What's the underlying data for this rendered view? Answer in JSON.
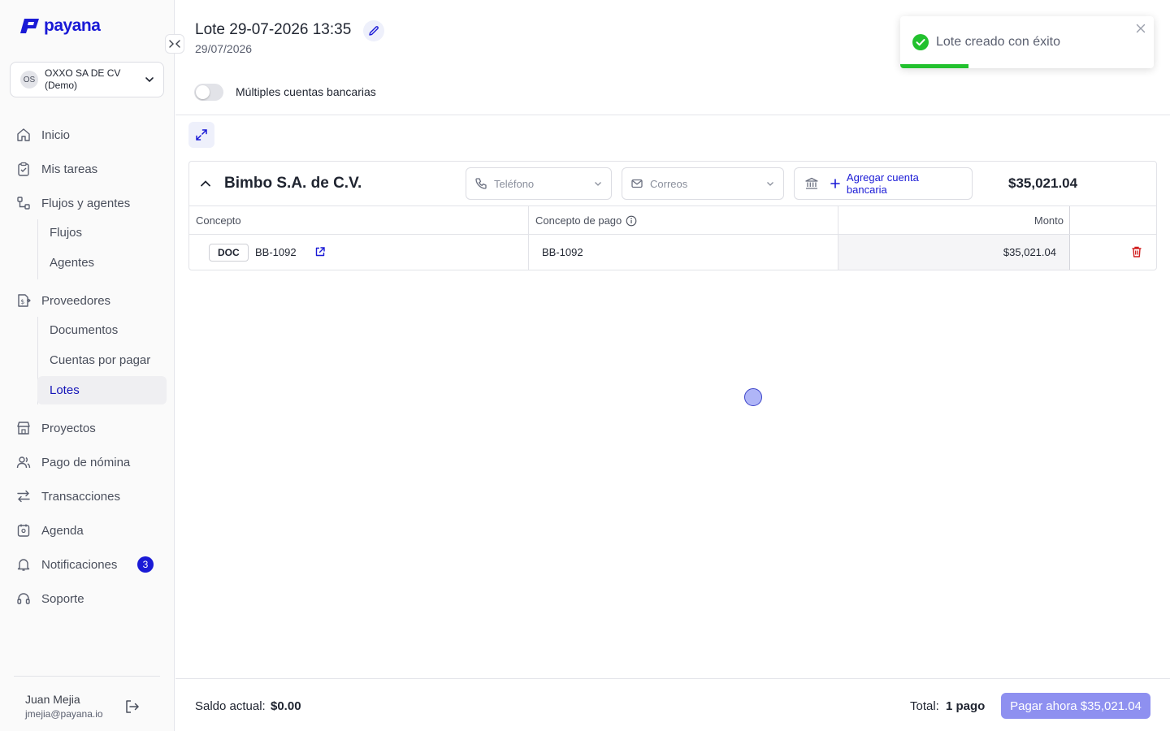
{
  "app": {
    "brand": "payana",
    "accent_color": "#1a1ad6"
  },
  "company": {
    "initials": "OS",
    "name": "OXXO SA DE CV (Demo)"
  },
  "nav": {
    "inicio": "Inicio",
    "tareas": "Mis tareas",
    "flujos_agentes": "Flujos y agentes",
    "flujos": "Flujos",
    "agentes": "Agentes",
    "proveedores": "Proveedores",
    "documentos": "Documentos",
    "cuentas": "Cuentas por pagar",
    "lotes": "Lotes",
    "proyectos": "Proyectos",
    "nomina": "Pago de nómina",
    "transacciones": "Transacciones",
    "agenda": "Agenda",
    "notificaciones": "Notificaciones",
    "notificaciones_count": "3",
    "soporte": "Soporte"
  },
  "user": {
    "name": "Juan Mejia",
    "email": "jmejia@payana.io"
  },
  "batch": {
    "title": "Lote 29-07-2026 13:35",
    "date": "29/07/2026",
    "toggle_label": "Múltiples cuentas bancarias",
    "toggle_on": false
  },
  "supplier": {
    "name": "Bimbo S.A. de C.V.",
    "phone_placeholder": "Teléfono",
    "email_placeholder": "Correos",
    "add_bank_label": "Agregar cuenta bancaria",
    "amount": "$35,021.04"
  },
  "table": {
    "headers": {
      "concepto": "Concepto",
      "concepto_pago": "Concepto de pago",
      "monto": "Monto"
    },
    "rows": [
      {
        "tag": "DOC",
        "doc_number": "BB-1092",
        "concepto_pago": "BB-1092",
        "monto": "$35,021.04"
      }
    ]
  },
  "toast": {
    "message": "Lote creado con éxito",
    "progress": 0.27,
    "status_color": "#22c12e"
  },
  "footer": {
    "saldo_label": "Saldo actual:",
    "saldo_value": "$0.00",
    "total_label": "Total:",
    "total_value": "1 pago",
    "pay_button": "Pagar ahora $35,021.04"
  },
  "icons": [
    "logo-icon",
    "collapse-icon",
    "chevron-down-icon",
    "home-icon",
    "clipboard-icon",
    "flows-icon",
    "supplier-icon",
    "store-icon",
    "users-icon",
    "arrows-icon",
    "calendar-icon",
    "bell-icon",
    "headset-icon",
    "logout-icon",
    "pencil-icon",
    "expand-icon",
    "chevron-up-icon",
    "phone-icon",
    "mail-icon",
    "bank-icon",
    "plus-icon",
    "info-icon",
    "external-link-icon",
    "trash-icon",
    "check-circle-icon",
    "close-icon"
  ]
}
